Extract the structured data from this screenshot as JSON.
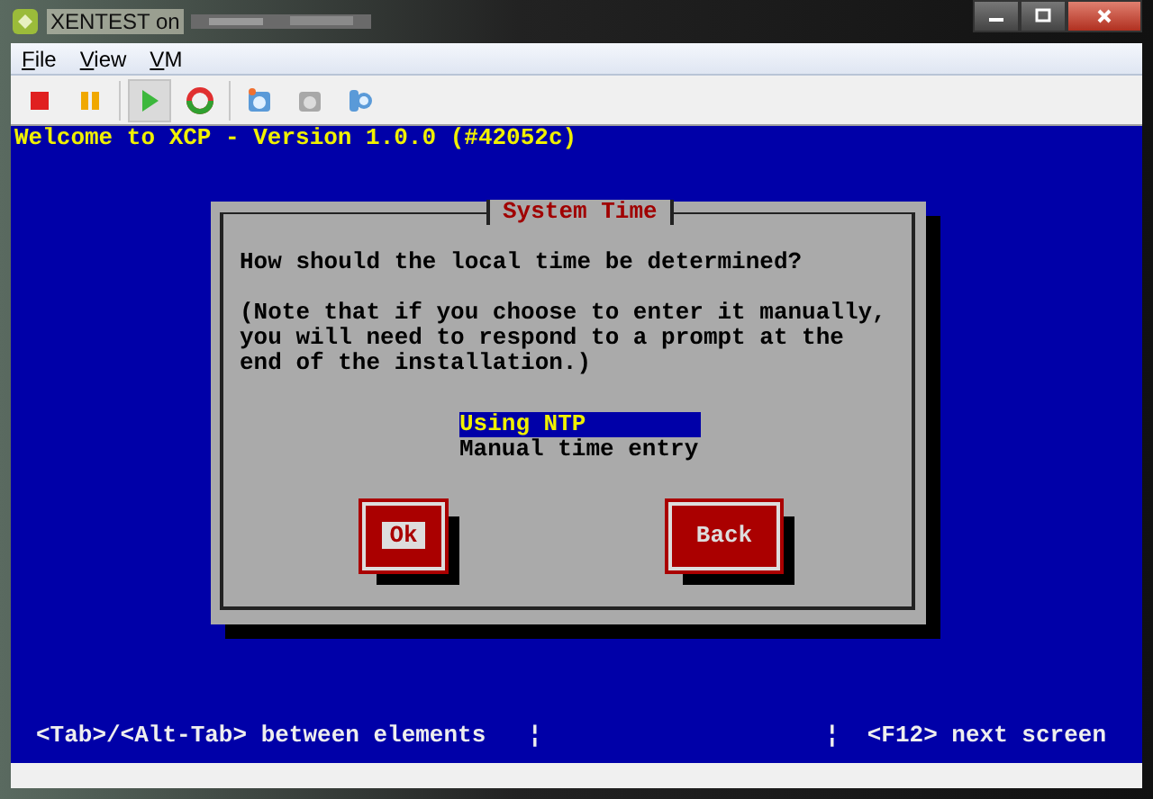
{
  "window": {
    "title": "XENTEST on"
  },
  "menu": [
    {
      "label": "File"
    },
    {
      "label": "View"
    },
    {
      "label": "VM"
    }
  ],
  "toolbar": [
    {
      "kind": "stop",
      "pressed": false
    },
    {
      "kind": "pause",
      "pressed": false
    },
    {
      "kind": "play",
      "pressed": true
    },
    {
      "kind": "reboot",
      "pressed": false
    },
    {
      "kind": "snapshot",
      "pressed": false
    },
    {
      "kind": "revert",
      "pressed": false
    },
    {
      "kind": "tools",
      "pressed": false
    }
  ],
  "console": {
    "header": "Welcome to XCP - Version 1.0.0 (#42052c)",
    "dialog": {
      "title": "System Time",
      "question": "How should the local time be determined?",
      "note": [
        "(Note that if you choose to enter it manually,",
        "you will need to respond to a prompt at the",
        "end of the installation.)"
      ],
      "options": [
        {
          "label": "Using NTP",
          "selected": true
        },
        {
          "label": "Manual time entry",
          "selected": false
        }
      ],
      "buttons": [
        {
          "label": "Ok",
          "focused": true
        },
        {
          "label": "Back",
          "focused": false
        }
      ]
    },
    "status_left": "<Tab>/<Alt-Tab> between elements   ¦",
    "status_right": "¦  <F12> next screen"
  }
}
